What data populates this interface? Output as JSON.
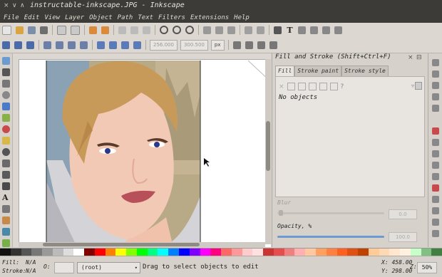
{
  "window": {
    "title": "instructable-inkscape.JPG - Inkscape",
    "controls": [
      "×",
      "∨",
      "∧"
    ]
  },
  "menu": [
    "File",
    "Edit",
    "View",
    "Layer",
    "Object",
    "Path",
    "Text",
    "Filters",
    "Extensions",
    "Help"
  ],
  "controls_bar": {
    "x_value": "256.000",
    "w_value": "300.500",
    "unit": "px"
  },
  "dock": {
    "title": "Fill and Stroke (Shift+Ctrl+F)",
    "tabs": [
      "Fill",
      "Stroke paint",
      "Stroke style"
    ],
    "no_objects": "No objects",
    "blur_label": "Blur",
    "blur_value": "0.0",
    "opacity_label": "Opacity, %",
    "opacity_value": "100.0",
    "paint_question": "?"
  },
  "status": {
    "fill_label": "Fill:",
    "fill_value": "N/A",
    "stroke_label": "Stroke:",
    "stroke_value": "N/A",
    "opacity_o": "O:",
    "layer": "(root)",
    "message": "Drag to select objects to edit",
    "x_coord": "X: 458.00",
    "y_coord": "Y: 298.00",
    "z_label": "Z:",
    "zoom": "50%"
  },
  "palette": [
    "#111111",
    "#333333",
    "#555555",
    "#777777",
    "#999999",
    "#bbbbbb",
    "#dddddd",
    "#ffffff",
    "#800000",
    "#ff0000",
    "#ff8000",
    "#ffff00",
    "#80ff00",
    "#00ff00",
    "#00ff80",
    "#00ffff",
    "#0080ff",
    "#0000ff",
    "#8000ff",
    "#ff00ff",
    "#ff0080",
    "#ff6666",
    "#ff9999",
    "#ffcccc",
    "#ffe0e0",
    "#cc3333",
    "#e64d4d",
    "#f08080",
    "#ffb0b0",
    "#ffc8a0",
    "#ffa060",
    "#ff8040",
    "#ff6020",
    "#e05010",
    "#c04000",
    "#ffcc99",
    "#ffd9b3",
    "#ffe6cc",
    "#fff0e0",
    "#c8ffc8",
    "#80c080",
    "#408040"
  ],
  "colors": {
    "titlebar": "#3c3b37",
    "accent_selection": "#6b9bd1",
    "skin": "#f2c9b4",
    "hair": "#c89a5a"
  }
}
